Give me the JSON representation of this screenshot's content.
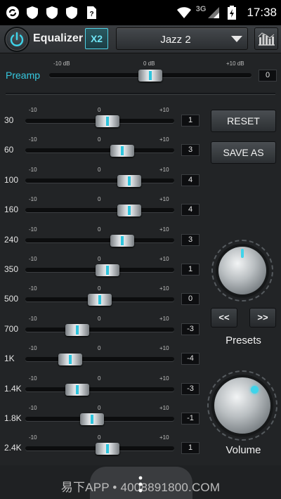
{
  "status_bar": {
    "network": "3G",
    "time": "17:38"
  },
  "header": {
    "title": "Equalizer",
    "x2_label": "X2",
    "preset_selected": "Jazz 2",
    "accent_color": "#36c9e0"
  },
  "preamp": {
    "label": "Preamp",
    "scale_min": "-10 dB",
    "scale_mid": "0 dB",
    "scale_max": "+10 dB",
    "value": "0",
    "level": 0
  },
  "band_scale": {
    "min": "-10",
    "mid": "0",
    "max": "+10"
  },
  "bands": [
    {
      "freq": "30",
      "value": "1",
      "level": 1
    },
    {
      "freq": "60",
      "value": "3",
      "level": 3
    },
    {
      "freq": "100",
      "value": "4",
      "level": 4
    },
    {
      "freq": "160",
      "value": "4",
      "level": 4
    },
    {
      "freq": "240",
      "value": "3",
      "level": 3
    },
    {
      "freq": "350",
      "value": "1",
      "level": 1
    },
    {
      "freq": "500",
      "value": "0",
      "level": 0
    },
    {
      "freq": "700",
      "value": "-3",
      "level": -3
    },
    {
      "freq": "1K",
      "value": "-4",
      "level": -4
    },
    {
      "freq": "1.4K",
      "value": "-3",
      "level": -3
    },
    {
      "freq": "1.8K",
      "value": "-1",
      "level": -1
    },
    {
      "freq": "2.4K",
      "value": "1",
      "level": 1
    }
  ],
  "controls": {
    "reset_label": "RESET",
    "save_as_label": "SAVE AS",
    "prev_label": "<<",
    "next_label": ">>",
    "presets_label": "Presets",
    "volume_label": "Volume"
  },
  "watermark": "易下APP • 4008891800.COM"
}
